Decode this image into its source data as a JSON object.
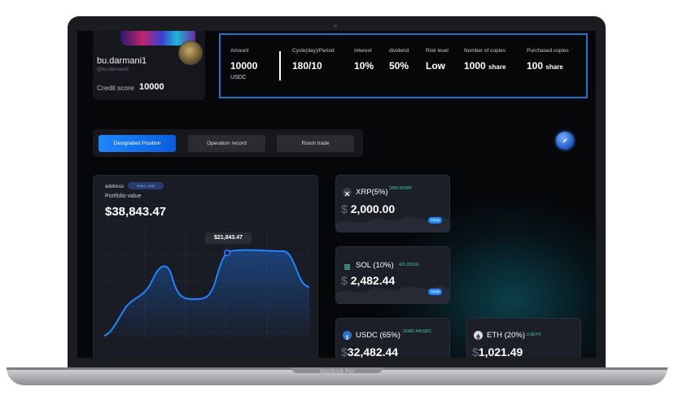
{
  "device": {
    "label": "MacBook Pro"
  },
  "profile": {
    "username": "bu.darmani1",
    "handle": "@bu.darmani1",
    "credit_label": "Credit score",
    "credit_value": "10000"
  },
  "stats": [
    {
      "label": "Amount",
      "value": "10000",
      "sub": "USDC"
    },
    {
      "label": "Cycle(day)/Period",
      "value": "180/10"
    },
    {
      "label": "Interest",
      "value": "10%"
    },
    {
      "label": "dividend",
      "value": "50%"
    },
    {
      "label": "Risk level",
      "value": "Low"
    },
    {
      "label": "Number of copies",
      "value": "1000",
      "unit": "share"
    },
    {
      "label": "Purchased copies",
      "value": "100",
      "unit": "share"
    }
  ],
  "tabs": [
    {
      "label": "Designated Position",
      "active": true
    },
    {
      "label": "Operation record",
      "active": false
    },
    {
      "label": "Room trade",
      "active": false
    }
  ],
  "fab": {
    "icon": "compass-icon"
  },
  "portfolio": {
    "address_label": "address",
    "address_badge": "0x4b1...89f4 ",
    "value_label": "Portfolio value",
    "value": "$38,843.47",
    "tooltip": "$21,843.47",
    "line_color": "#1f86ff"
  },
  "assets": [
    {
      "name": "XRP(5%)",
      "amount": "2000.00XRP",
      "usd_symbol": "$",
      "usd": "2,000.00",
      "swap": "Swap",
      "icon": "xrp-icon"
    },
    {
      "name": "SOL (10%)",
      "amount": "421.00SOL",
      "usd_symbol": "$",
      "usd": "2,482.44",
      "swap": "Swap",
      "icon": "sol-icon"
    },
    {
      "name": "USDC (65%)",
      "amount": "32482.44USDC",
      "usd_symbol": "$",
      "usd": "32,482.44",
      "icon": "usdc-icon"
    },
    {
      "name": "ETH (20%)",
      "amount": "0.9ETH",
      "usd_symbol": "$",
      "usd": "1,021.49",
      "icon": "eth-icon"
    }
  ]
}
